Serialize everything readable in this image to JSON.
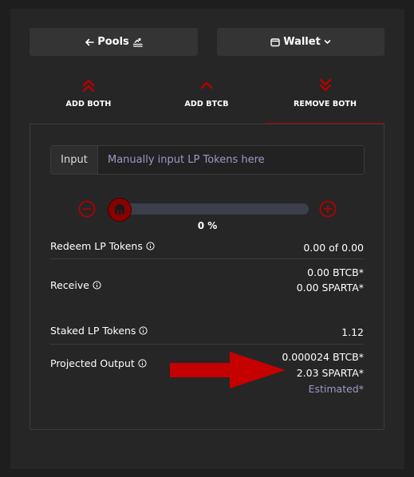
{
  "nav": {
    "pools_label": "Pools",
    "wallet_label": "Wallet"
  },
  "tabs": [
    {
      "label": "ADD BOTH",
      "icon": "double-chevron-up-icon"
    },
    {
      "label": "ADD BTCB",
      "icon": "chevron-up-icon"
    },
    {
      "label": "REMOVE BOTH",
      "icon": "double-chevron-down-icon",
      "active": true
    }
  ],
  "input": {
    "label": "Input",
    "placeholder": "Manually input LP Tokens here"
  },
  "slider": {
    "percent_label": "0 %",
    "value_fraction": 0
  },
  "details": {
    "redeem": {
      "label": "Redeem LP Tokens",
      "value": "0.00 of 0.00"
    },
    "receive": {
      "label": "Receive",
      "value1": "0.00 BTCB*",
      "value2": "0.00 SPARTA*"
    },
    "staked": {
      "label": "Staked LP Tokens",
      "value": "1.12"
    },
    "projected": {
      "label": "Projected Output",
      "value1": "0.000024 BTCB*",
      "value2": "2.03 SPARTA*",
      "value3": "Estimated*"
    }
  },
  "colors": {
    "accent": "#b30000",
    "estimated": "#9a9ac8"
  }
}
